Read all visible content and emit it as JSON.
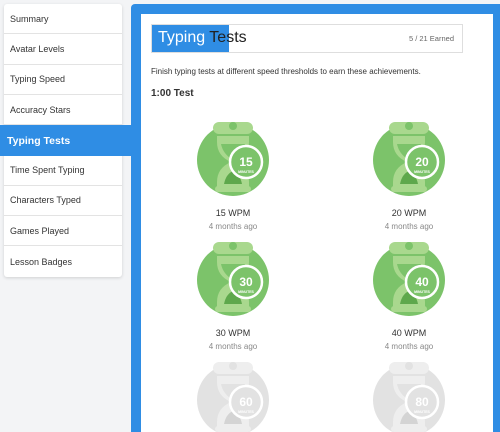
{
  "sidebar": {
    "items": [
      {
        "label": "Summary"
      },
      {
        "label": "Avatar Levels"
      },
      {
        "label": "Typing Speed"
      },
      {
        "label": "Accuracy Stars"
      },
      {
        "label": "Typing Tests"
      },
      {
        "label": "Time Spent Typing"
      },
      {
        "label": "Characters Typed"
      },
      {
        "label": "Games Played"
      },
      {
        "label": "Lesson Badges"
      }
    ],
    "active_index": 4
  },
  "header": {
    "title": "Typing Tests",
    "earned": "5 / 21 Earned"
  },
  "description": "Finish typing tests at different speed thresholds to earn these achievements.",
  "section_title": "1:00 Test",
  "badges": [
    {
      "number": "15",
      "unit": "MINUTES",
      "wpm": "15 WPM",
      "when": "4 months ago",
      "earned": true
    },
    {
      "number": "20",
      "unit": "MINUTES",
      "wpm": "20 WPM",
      "when": "4 months ago",
      "earned": true
    },
    {
      "number": "30",
      "unit": "MINUTES",
      "wpm": "30 WPM",
      "when": "4 months ago",
      "earned": true
    },
    {
      "number": "40",
      "unit": "MINUTES",
      "wpm": "40 WPM",
      "when": "4 months ago",
      "earned": true
    },
    {
      "number": "60",
      "unit": "MINUTES",
      "earned": false
    },
    {
      "number": "80",
      "unit": "MINUTES",
      "earned": false
    }
  ],
  "colors": {
    "accent": "#2f8de4",
    "badge_earned": "#7cc36a",
    "badge_light": "#a9d88e",
    "badge_locked": "#e2e2e2"
  }
}
